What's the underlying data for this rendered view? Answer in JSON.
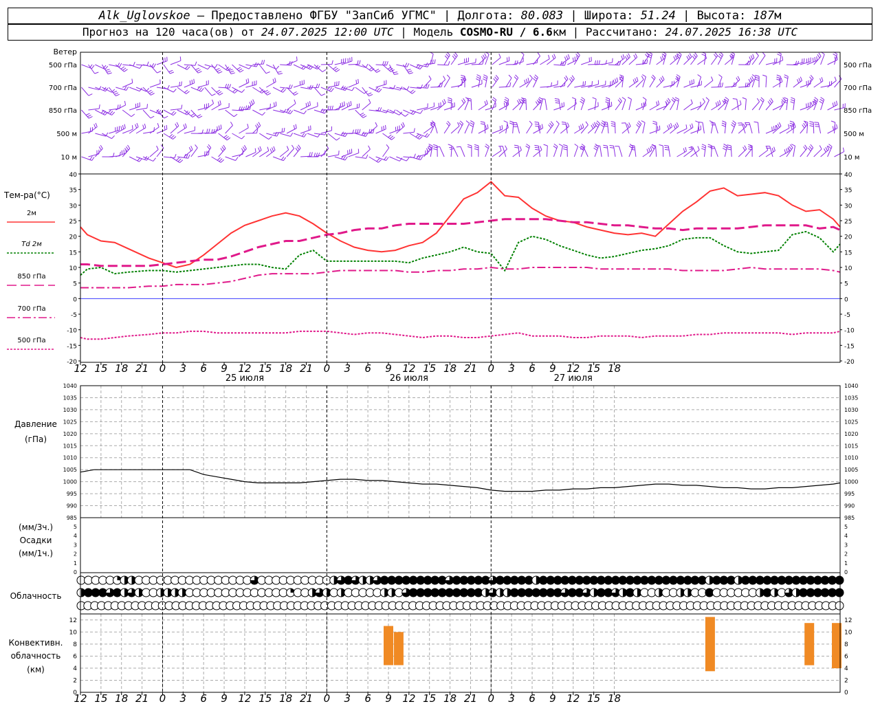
{
  "header": {
    "station": "Alk_Uglovskoe",
    "provider": " – Предоставлено ФГБУ \"ЗапСиб УГМС\" | Долгота: ",
    "lon": "80.083",
    "lat_label": " | Широта: ",
    "lat": "51.24",
    "alt_label": " | Высота: ",
    "alt": "187",
    "alt_unit": "м",
    "forecast_label": "Прогноз на 120 часа(ов) от ",
    "forecast_time": "24.07.2025 12:00 UTC",
    "model_label": "  | Модель ",
    "model": "COSMO-RU / 6.6",
    "model_unit": "км",
    "calc_label": " | Рассчитано: ",
    "calc_time": "24.07.2025 16:38 UTC"
  },
  "time_axis": {
    "hour_ticks": [
      "12",
      "15",
      "18",
      "21",
      "0",
      "3",
      "6",
      "9",
      "12",
      "15",
      "18",
      "21",
      "0",
      "3",
      "6",
      "9",
      "12",
      "15",
      "18",
      "21",
      "0",
      "3",
      "6",
      "9",
      "12",
      "15",
      "18"
    ],
    "day_labels": [
      {
        "label": "25 июля",
        "index": 8
      },
      {
        "label": "26 июля",
        "index": 16
      },
      {
        "label": "27 июля",
        "index": 24
      }
    ],
    "midnight_indices": [
      4,
      12,
      20
    ]
  },
  "wind_panel": {
    "title": "Ветер",
    "levels": [
      "500 гПа",
      "700 гПа",
      "850 гПа",
      "500 м",
      "10  м"
    ],
    "right_levels": [
      "500 гПа",
      "700 гПа",
      "850 гПа",
      "500 м",
      "10  м"
    ],
    "barb_color": "#8a2be2"
  },
  "temp_panel": {
    "title": "Тем-ра(°С)",
    "legend": [
      {
        "label": "2м",
        "color": "#ff3333",
        "dash": ""
      },
      {
        "label": "Td  2м",
        "color": "#008000",
        "dash": "3,2"
      },
      {
        "label": "850 гПа",
        "color": "#e0198a",
        "dash": "14,6"
      },
      {
        "label": "700 гПа",
        "color": "#e0198a",
        "dash": "12,4,3,4"
      },
      {
        "label": "500 гПа",
        "color": "#e0198a",
        "dash": "3,2"
      }
    ],
    "y_ticks": [
      "40",
      "35",
      "30",
      "25",
      "20",
      "15",
      "10",
      "5",
      "0",
      "-5",
      "-10",
      "-15",
      "-20"
    ]
  },
  "pressure_panel": {
    "title": "Давление",
    "unit": "(гПа)",
    "y_ticks": [
      "1040",
      "1035",
      "1030",
      "1025",
      "1020",
      "1015",
      "1010",
      "1005",
      "1000",
      "995",
      "990",
      "985"
    ]
  },
  "precip_panel": {
    "unit_3h": "(мм/3ч.)",
    "title": "Осадки",
    "unit_1h": "(мм/1ч.)",
    "y_ticks": [
      "5",
      "4",
      "3",
      "2",
      "1",
      "0"
    ]
  },
  "cloud_panel": {
    "title": "Облачность"
  },
  "conv_panel": {
    "title_1": "Конвективн.",
    "title_2": "облачность",
    "unit": "(км)",
    "y_ticks": [
      "12",
      "10",
      "8",
      "6",
      "4",
      "2",
      "0"
    ],
    "bar_color": "#f08a24"
  },
  "chart_data": [
    {
      "type": "line",
      "name": "temperature",
      "x_hours_from_start": [
        0,
        1,
        3,
        5,
        7,
        10,
        12,
        14,
        16,
        18,
        20,
        22,
        24,
        26,
        28,
        30,
        32,
        34,
        36,
        38,
        40,
        42,
        44,
        46,
        48,
        50,
        52,
        54,
        56,
        58,
        60,
        62,
        64,
        66,
        68,
        70,
        72,
        74,
        76,
        78,
        80,
        82,
        84,
        86,
        88,
        90,
        92,
        94,
        96,
        98,
        100,
        102,
        104,
        106,
        108,
        110,
        111
      ],
      "series": [
        {
          "name": "2м",
          "values": [
            23,
            20.5,
            18.5,
            18,
            16,
            13,
            11.5,
            10,
            11,
            14,
            17.5,
            21,
            23.5,
            25,
            26.5,
            27.5,
            26.5,
            24,
            21,
            18.5,
            16.5,
            15.5,
            15,
            15.5,
            17,
            18,
            21,
            26.5,
            32,
            34,
            37.5,
            33,
            32.5,
            29,
            26.5,
            25,
            24.5,
            23,
            22,
            21,
            20.5,
            21,
            20,
            24,
            28,
            31,
            34.5,
            35.5,
            33,
            33.5,
            34,
            33,
            30,
            28,
            28.5,
            25.5,
            23
          ]
        },
        {
          "name": "Td  2м",
          "values": [
            7.5,
            9.5,
            10,
            8,
            8.5,
            9,
            9,
            8.5,
            9,
            9.5,
            10,
            10.5,
            11,
            11,
            10,
            9.5,
            14,
            15.5,
            12,
            12,
            12,
            12,
            12,
            12,
            11.5,
            13,
            14,
            15,
            16.5,
            15,
            14.5,
            9,
            18,
            20,
            19,
            17,
            15.5,
            14,
            13,
            13.5,
            14.5,
            15.5,
            16,
            17,
            19,
            19.5,
            19.5,
            17,
            15,
            14.5,
            15,
            15.5,
            20.5,
            21.5,
            19.5,
            15,
            17.5
          ]
        },
        {
          "name": "850 гПа",
          "values": [
            11,
            11,
            10.5,
            10.5,
            10.5,
            10.5,
            11,
            11.5,
            12,
            12.5,
            12.5,
            13.5,
            15,
            16.5,
            17.5,
            18.5,
            18.5,
            19.5,
            20.5,
            21,
            22,
            22.5,
            22.5,
            23.5,
            24,
            24,
            24,
            24,
            24,
            24.5,
            25,
            25.5,
            25.5,
            25.5,
            25.5,
            25,
            24.5,
            24.5,
            24,
            23.5,
            23.5,
            23,
            22.5,
            22.5,
            22,
            22.5,
            22.5,
            22.5,
            22.5,
            23,
            23.5,
            23.5,
            23.5,
            23.5,
            22.5,
            23,
            22
          ]
        },
        {
          "name": "700 гПа",
          "values": [
            3.5,
            3.5,
            3.5,
            3.5,
            3.5,
            4,
            4,
            4.5,
            4.5,
            4.5,
            5,
            5.5,
            6.5,
            7.5,
            8,
            8,
            8,
            8,
            8.5,
            9,
            9,
            9,
            9,
            9,
            8.5,
            8.5,
            9,
            9,
            9.5,
            9.5,
            10,
            9.5,
            9.5,
            10,
            10,
            10,
            10,
            10,
            9.5,
            9.5,
            9.5,
            9.5,
            9.5,
            9.5,
            9,
            9,
            9,
            9,
            9.5,
            10,
            9.5,
            9.5,
            9.5,
            9.5,
            9.5,
            9,
            8.5
          ]
        },
        {
          "name": "500 гПа",
          "values": [
            -12.5,
            -13,
            -13,
            -12.5,
            -12,
            -11.5,
            -11,
            -11,
            -10.5,
            -10.5,
            -11,
            -11,
            -11,
            -11,
            -11,
            -11,
            -10.5,
            -10.5,
            -10.5,
            -11,
            -11.5,
            -11,
            -11,
            -11.5,
            -12,
            -12.5,
            -12,
            -12,
            -12.5,
            -12.5,
            -12,
            -11.5,
            -11,
            -12,
            -12,
            -12,
            -12.5,
            -12.5,
            -12,
            -12,
            -12,
            -12.5,
            -12,
            -12,
            -12,
            -11.5,
            -11.5,
            -11,
            -11,
            -11,
            -11,
            -11,
            -11.5,
            -11,
            -11,
            -11,
            -10.5
          ]
        }
      ],
      "ylim": [
        -20,
        40
      ]
    },
    {
      "type": "line",
      "name": "pressure",
      "x_hours_from_start": [
        0,
        2,
        4,
        6,
        8,
        10,
        12,
        14,
        16,
        18,
        20,
        22,
        24,
        26,
        28,
        30,
        32,
        34,
        36,
        38,
        40,
        42,
        44,
        46,
        48,
        50,
        52,
        54,
        56,
        58,
        60,
        62,
        64,
        66,
        68,
        70,
        72,
        74,
        76,
        78,
        80,
        82,
        84,
        86,
        88,
        90,
        92,
        94,
        96,
        98,
        100,
        102,
        104,
        106,
        108,
        110,
        111
      ],
      "series": [
        {
          "name": "давление",
          "values": [
            1004,
            1005,
            1005,
            1005,
            1005,
            1005,
            1005,
            1005,
            1005,
            1003,
            1002,
            1001,
            1000,
            999.5,
            999.5,
            999.5,
            999.5,
            1000,
            1000.5,
            1001,
            1001,
            1000.5,
            1000.5,
            1000,
            999.5,
            999,
            999,
            998.5,
            998,
            997.5,
            996.5,
            996,
            996,
            996,
            996.5,
            996.5,
            997,
            997,
            997.5,
            997.5,
            998,
            998.5,
            999,
            999,
            998.5,
            998.5,
            998,
            997.5,
            997.5,
            997,
            997,
            997.5,
            997.5,
            998,
            998.5,
            999,
            999.5
          ]
        }
      ],
      "ylim": [
        985,
        1040
      ]
    },
    {
      "type": "bar",
      "name": "convective cloudiness",
      "bars_hours_from_start": [
        {
          "x": 45,
          "bottom": 4.5,
          "top": 11
        },
        {
          "x": 46.5,
          "bottom": 4.5,
          "top": 10
        },
        {
          "x": 92,
          "bottom": 3.5,
          "top": 12.5
        },
        {
          "x": 106.5,
          "bottom": 4.5,
          "top": 11.5
        },
        {
          "x": 110.5,
          "bottom": 4,
          "top": 11.5
        }
      ],
      "ylim": [
        0,
        13
      ]
    },
    {
      "type": "table",
      "name": "cloud cover (fraction per symbol, 3 rows)",
      "rows": [
        [
          0,
          0,
          0,
          0,
          0,
          0.25,
          0.5,
          0.5,
          0,
          0,
          0,
          0,
          0,
          0,
          0,
          0,
          0,
          0,
          0,
          0,
          0,
          0,
          0,
          0,
          0.75,
          0,
          0,
          0,
          0,
          0,
          0,
          0,
          0,
          0,
          0,
          0.5,
          0.75,
          1,
          0.75,
          0.5,
          0.5,
          0.75,
          1,
          1,
          1,
          1,
          1,
          1,
          1,
          1,
          1,
          0.75,
          1,
          1,
          1,
          1,
          1,
          0.75,
          1,
          1,
          1,
          1,
          1,
          0.5,
          1,
          1,
          1,
          1,
          1,
          1,
          1,
          1,
          1,
          1,
          1,
          1,
          1,
          1,
          1,
          1,
          1,
          1,
          1,
          1,
          1,
          1,
          1,
          0.5,
          1,
          1,
          1,
          0.5,
          1,
          1,
          1,
          1,
          1,
          1,
          1,
          1,
          1,
          1,
          1,
          1,
          1,
          1
        ],
        [
          0.5,
          1,
          1,
          1,
          0.75,
          1,
          0.5,
          0.75,
          0.5,
          0,
          0,
          0.5,
          0.5,
          0.5,
          0.5,
          0,
          0,
          0,
          0,
          0,
          0,
          0,
          0,
          0,
          0,
          0,
          0,
          0,
          0,
          0.25,
          0,
          0,
          0.5,
          0.75,
          0.5,
          0,
          0.5,
          0,
          0,
          0,
          0,
          0,
          0.5,
          0.5,
          0,
          0.75,
          1,
          1,
          1,
          1,
          1,
          1,
          1,
          1,
          1,
          1,
          0.5,
          0.75,
          0.5,
          0.5,
          1,
          1,
          1,
          1,
          1,
          1,
          1,
          0.75,
          1,
          1,
          0.75,
          0.5,
          1,
          1,
          0.75,
          0.5,
          1,
          0.5,
          0,
          0,
          0.5,
          0,
          0,
          0.5,
          0.5,
          0,
          0,
          1,
          0,
          0,
          0,
          0,
          0,
          0,
          0.5,
          1,
          0.5,
          0,
          0.75,
          0.5,
          1,
          1,
          1,
          1,
          1,
          1
        ],
        [
          0,
          0,
          0,
          0,
          0,
          0,
          0,
          0,
          0,
          0,
          0,
          0,
          0,
          0,
          0,
          0,
          0,
          0,
          0,
          0,
          0,
          0,
          0,
          0,
          0,
          0,
          0,
          0,
          0,
          0,
          0,
          0,
          0,
          0,
          0,
          0,
          0,
          0,
          0,
          0,
          0,
          0,
          0,
          0,
          0,
          0,
          0,
          0,
          0,
          0,
          0,
          0,
          0,
          0,
          0,
          0,
          0,
          0,
          0,
          0,
          0,
          0,
          0,
          0,
          0,
          0,
          0,
          0,
          0,
          0,
          0,
          0,
          0,
          0,
          0,
          0,
          0,
          0,
          0,
          0,
          0,
          0,
          0,
          0,
          0,
          0,
          0,
          0,
          0,
          0,
          0,
          0,
          0,
          0,
          0,
          0,
          0,
          0,
          0,
          0,
          0,
          0,
          0,
          0,
          0,
          0,
          0,
          0,
          0,
          0,
          0,
          0,
          0
        ]
      ]
    }
  ]
}
